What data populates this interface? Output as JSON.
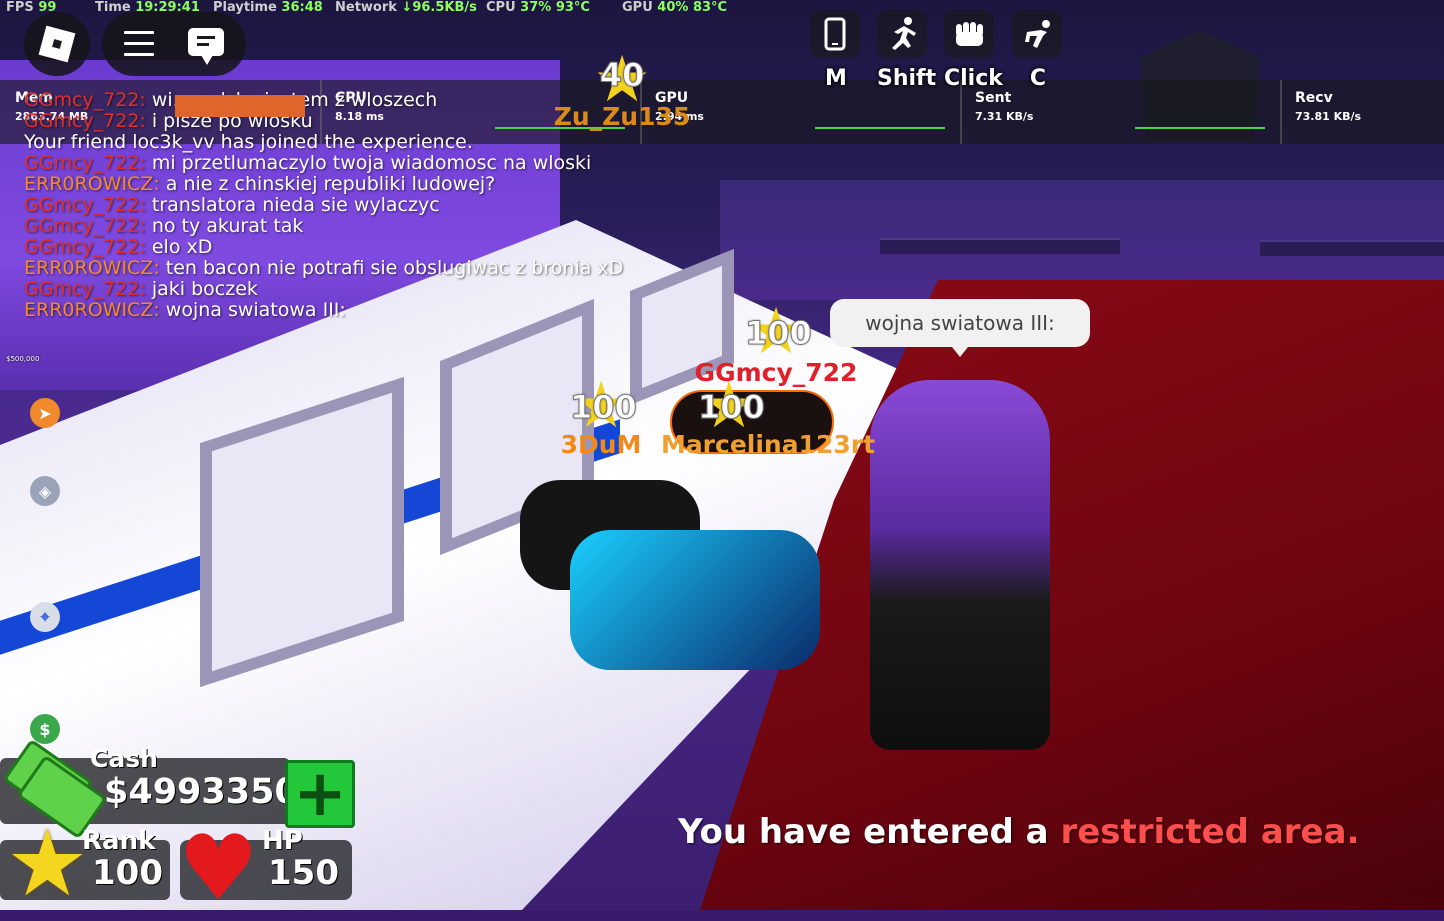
{
  "stats_bar": {
    "fps_label": "FPS",
    "fps_value": "99",
    "time_label": "Time",
    "time_value": "19:29:41",
    "playtime_label": "Playtime",
    "playtime_value": "36:48",
    "network_label": "Network",
    "network_value": "↓96.5KB/s",
    "cpu_label": "CPU",
    "cpu_value": "37%",
    "cpu_temp": "93°C",
    "gpu_label": "GPU",
    "gpu_value": "40%",
    "gpu_temp": "83°C"
  },
  "perf_overlay": [
    {
      "label": "Mem",
      "value": "2863.74 MB"
    },
    {
      "label": "CPU",
      "value": "8.18 ms"
    },
    {
      "label": "GPU",
      "value": "2.94 ms"
    },
    {
      "label": "Sent",
      "value": "7.31 KB/s"
    },
    {
      "label": "Recv",
      "value": "73.81 KB/s"
    }
  ],
  "controls": [
    {
      "key": "M",
      "icon": "mobile-phone-icon"
    },
    {
      "key": "Shift",
      "icon": "sprint-icon"
    },
    {
      "key": "Click",
      "icon": "punch-fist-icon"
    },
    {
      "key": "C",
      "icon": "crouch-icon"
    }
  ],
  "chat": [
    {
      "user": "GGmcy_722:",
      "text": " wi... polsku jestem z wloszech",
      "user_color": "#e0302a"
    },
    {
      "user": "GGmcy_722:",
      "text": " i pisze po wlosku",
      "user_color": "#e0302a"
    },
    {
      "user": "",
      "text": "Your friend loc3k_vv has joined the experience.",
      "user_color": "#ffffff"
    },
    {
      "user": "GGmcy_722:",
      "text": " mi przetlumaczylo twoja wiadomosc na wloski",
      "user_color": "#e0302a"
    },
    {
      "user": "ERR0ROWICZ:",
      "text": " a nie z chinskiej republiki ludowej?",
      "user_color": "#f28a2c"
    },
    {
      "user": "GGmcy_722:",
      "text": " translatora nieda sie wylaczyc",
      "user_color": "#e0302a"
    },
    {
      "user": "GGmcy_722:",
      "text": " no ty akurat tak",
      "user_color": "#e0302a"
    },
    {
      "user": "GGmcy_722:",
      "text": " elo xD",
      "user_color": "#e0302a"
    },
    {
      "user": "ERR0ROWICZ:",
      "text": " ten bacon nie potrafi sie obslugiwac z bronia xD",
      "user_color": "#f28a2c"
    },
    {
      "user": "GGmcy_722:",
      "text": " jaki boczek",
      "user_color": "#e0302a"
    },
    {
      "user": "ERR0ROWICZ:",
      "text": " wojna swiatowa III:",
      "user_color": "#f28a2c"
    }
  ],
  "nameplates": [
    {
      "level": "40",
      "name": "Zu_Zu135",
      "color": "#d98a1a"
    },
    {
      "level": "100",
      "name": "GGmcy_722",
      "color": "#e0202a"
    },
    {
      "level": "100",
      "name": "3DuM",
      "color": "#f08a1a"
    },
    {
      "level": "100",
      "name": "Marcelina123rt",
      "color": "#f0a030"
    }
  ],
  "speech_bubble": "wojna swiatowa III:",
  "side_menu": {
    "price_tag": "$500,000",
    "icons": [
      "compass-icon",
      "layers-icon",
      "gps-pin-icon",
      "dollar-icon"
    ]
  },
  "hud": {
    "cash_label": "Cash",
    "cash_value": "$4993350",
    "add_cash": "+",
    "rank_label": "Rank",
    "rank_value": "100",
    "hp_label": "HP",
    "hp_value": "150"
  },
  "notification": {
    "prefix": "You have entered a ",
    "highlight": "restricted area."
  },
  "colors": {
    "stats_value": "#8bff5a",
    "restricted": "#ff4e4e",
    "cash_button": "#22c73a"
  }
}
